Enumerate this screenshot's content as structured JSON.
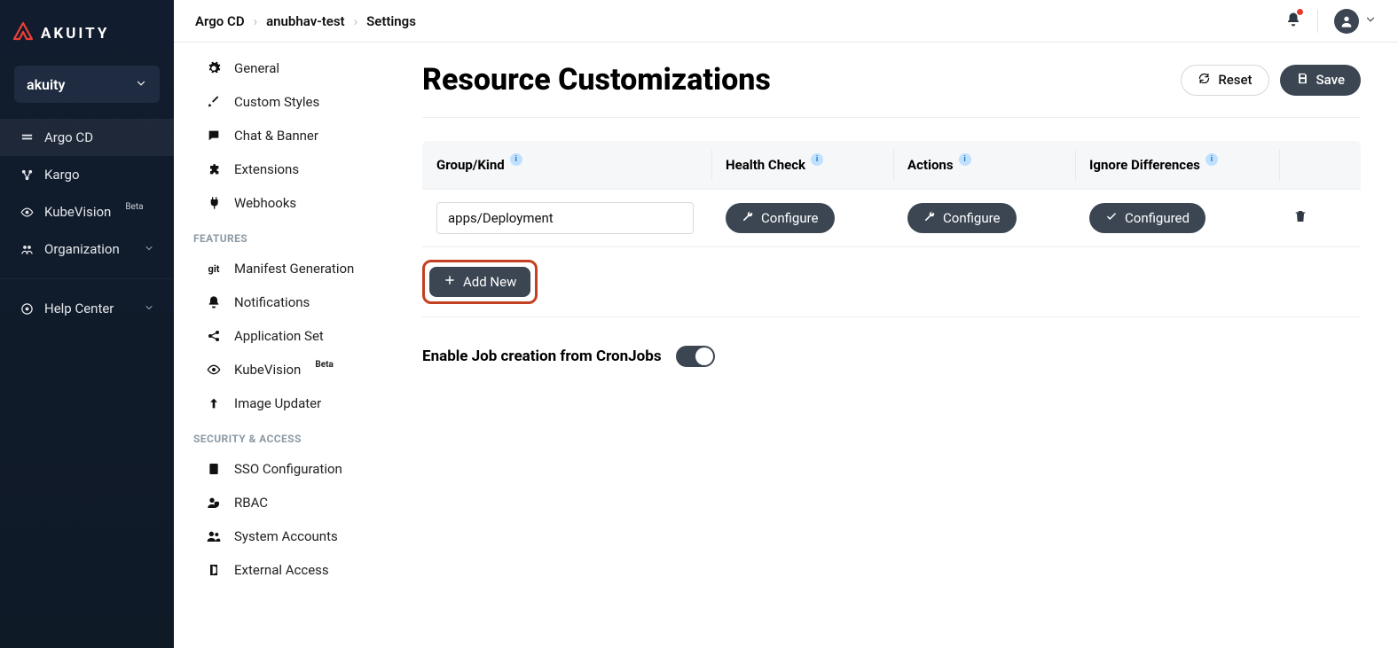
{
  "brand": {
    "name": "AKUITY"
  },
  "org_selector": {
    "name": "akuity"
  },
  "dark_sidebar": {
    "items": [
      {
        "label": "Argo CD",
        "active": true
      },
      {
        "label": "Kargo"
      },
      {
        "label": "KubeVision",
        "badge": "Beta"
      },
      {
        "label": "Organization",
        "expandable": true
      }
    ],
    "footer_item": {
      "label": "Help Center",
      "expandable": true
    }
  },
  "breadcrumbs": {
    "items": [
      "Argo CD",
      "anubhav-test",
      "Settings"
    ]
  },
  "light_sidebar": {
    "top": [
      {
        "label": "General",
        "icon": "gear-icon"
      },
      {
        "label": "Custom Styles",
        "icon": "brush-icon"
      },
      {
        "label": "Chat & Banner",
        "icon": "chat-icon"
      },
      {
        "label": "Extensions",
        "icon": "puzzle-icon"
      },
      {
        "label": "Webhooks",
        "icon": "plug-icon"
      }
    ],
    "features_title": "FEATURES",
    "features": [
      {
        "label": "Manifest Generation",
        "icon": "git-icon",
        "icon_text": "git"
      },
      {
        "label": "Notifications",
        "icon": "bell-icon"
      },
      {
        "label": "Application Set",
        "icon": "share-icon"
      },
      {
        "label": "KubeVision",
        "icon": "eye-icon",
        "badge": "Beta"
      },
      {
        "label": "Image Updater",
        "icon": "arrow-up-icon"
      }
    ],
    "security_title": "SECURITY & ACCESS",
    "security": [
      {
        "label": "SSO Configuration",
        "icon": "id-icon"
      },
      {
        "label": "RBAC",
        "icon": "user-shield-icon"
      },
      {
        "label": "System Accounts",
        "icon": "users-icon"
      },
      {
        "label": "External Access",
        "icon": "door-icon"
      }
    ]
  },
  "page": {
    "title": "Resource Customizations",
    "reset": "Reset",
    "save": "Save"
  },
  "table": {
    "headers": {
      "group_kind": "Group/Kind",
      "health_check": "Health Check",
      "actions": "Actions",
      "ignore_diff": "Ignore Differences"
    },
    "rows": [
      {
        "group_kind": "apps/Deployment",
        "health_check_label": "Configure",
        "actions_label": "Configure",
        "ignore_diff_label": "Configured"
      }
    ],
    "add_new": "Add New"
  },
  "toggle": {
    "label": "Enable Job creation from CronJobs",
    "on": true
  }
}
